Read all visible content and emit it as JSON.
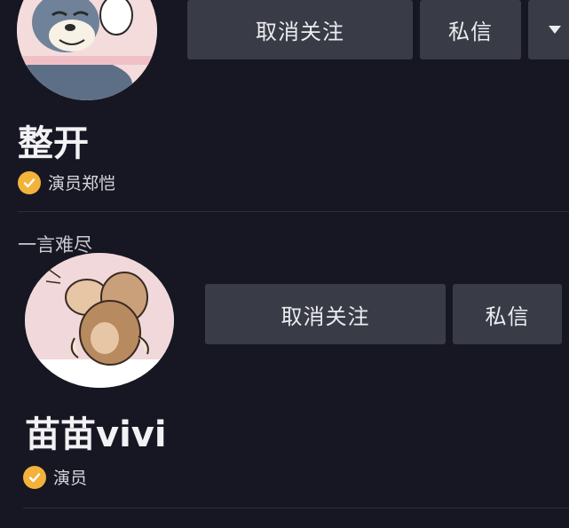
{
  "profiles": [
    {
      "name": "整开",
      "verified_label": "演员郑恺",
      "bio": "一言难尽",
      "unfollow_label": "取消关注",
      "message_label": "私信",
      "avatar_icon": "tom-cat-avatar-icon"
    },
    {
      "name": "苗苗vivi",
      "verified_label": "演员",
      "unfollow_label": "取消关注",
      "message_label": "私信",
      "avatar_icon": "jerry-mouse-avatar-icon"
    }
  ],
  "colors": {
    "background": "#161722",
    "button": "#393b46",
    "verified_badge": "#f3b23a"
  }
}
